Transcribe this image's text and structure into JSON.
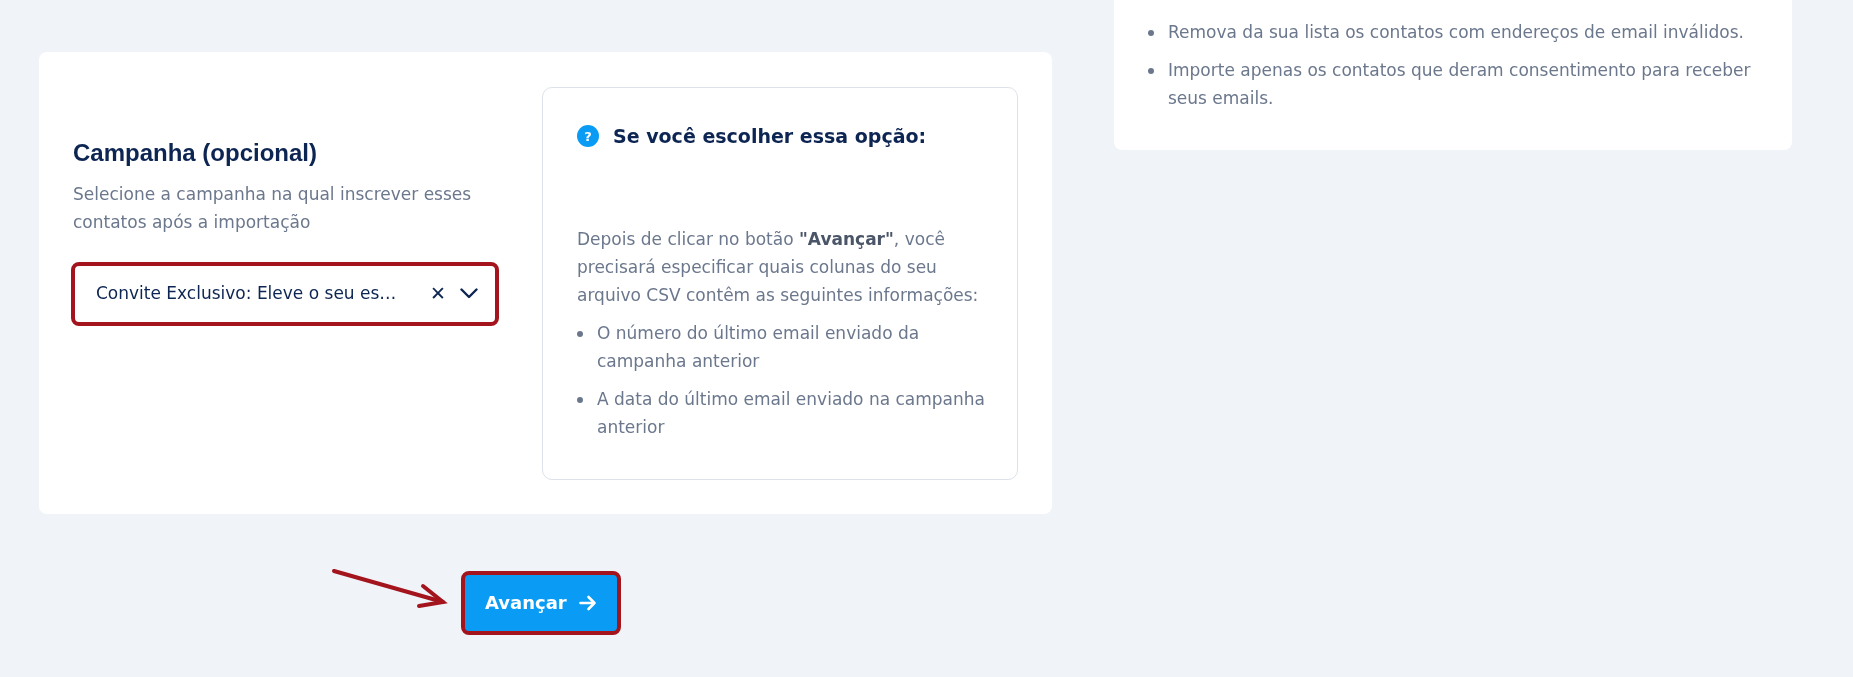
{
  "campaign": {
    "title": "Campanha (opcional)",
    "description": "Selecione a campanha na qual inscrever esses contatos após a importação",
    "select": {
      "value": "Convite Exclusivo: Eleve o seu es…",
      "clear": "✕",
      "highlighted": true
    }
  },
  "info": {
    "title": "Se você escolher essa opção:",
    "icon": "?",
    "text": "Depois de clicar no botão **\"Avançar\"**, você precisará especificar quais colunas do seu arquivo CSV contêm as seguintes informações:",
    "bullets": [
      "O número do último email enviado da campanha anterior",
      "A data do último email enviado na campanha anterior"
    ]
  },
  "tips": {
    "bullets": [
      "Remova da sua lista os contatos com endereços de email inválidos.",
      "Importe apenas os contatos que deram consentimento para receber seus emails."
    ]
  },
  "next_button": {
    "label": "Avançar",
    "highlighted": true
  }
}
